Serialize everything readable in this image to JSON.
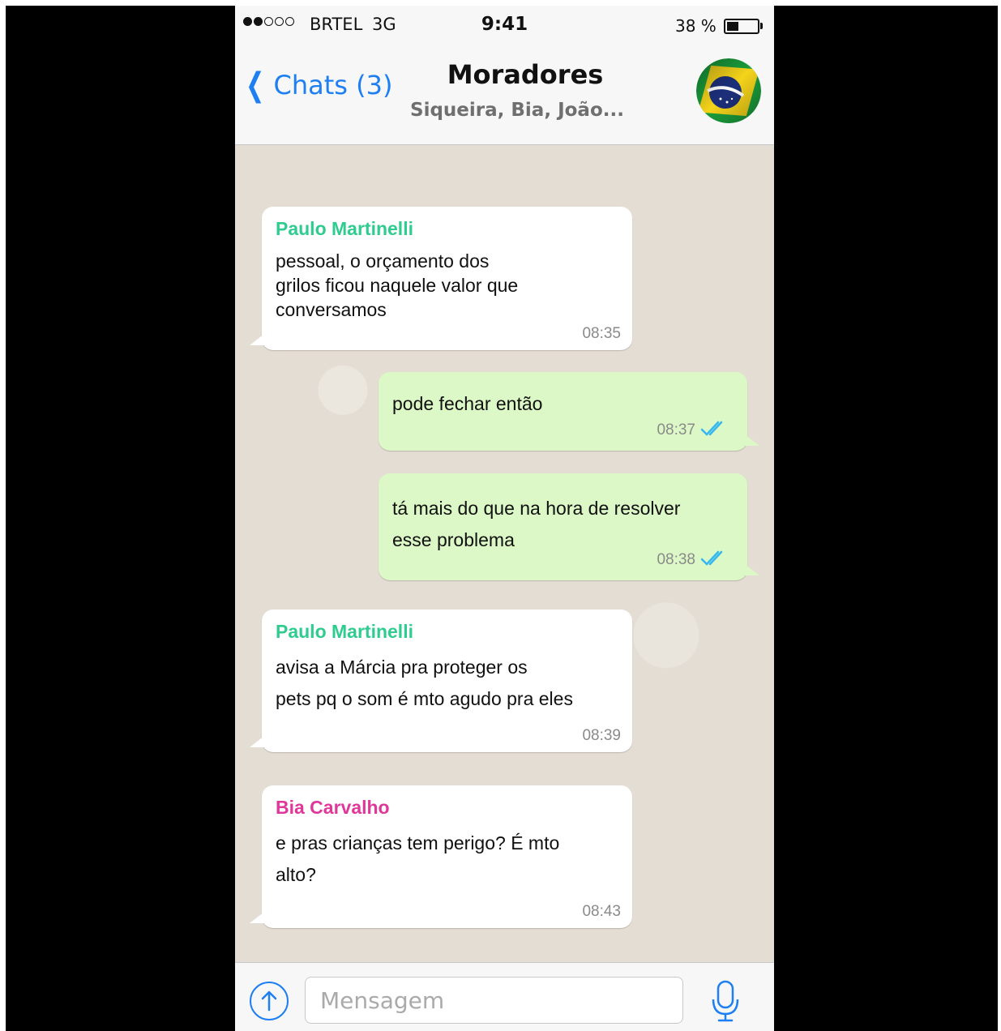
{
  "status_bar": {
    "carrier": "BRTEL",
    "network": "3G",
    "time": "9:41",
    "battery_percent": "38 %",
    "battery_level": 0.38,
    "signal_strength": 2,
    "signal_max": 5
  },
  "nav": {
    "back_label": "Chats (3)",
    "title": "Moradores",
    "subtitle": "Siqueira, Bia, João...",
    "avatar_icon": "brazil-flag-icon"
  },
  "messages": [
    {
      "direction": "in",
      "sender": "Paulo Martinelli",
      "sender_color": "#2ecc8f",
      "text": "pessoal, o orçamento dos\ngrilos ficou naquele valor que\nconversamos",
      "time": "08:35"
    },
    {
      "direction": "out",
      "text": "pode fechar então",
      "time": "08:37",
      "status": "read"
    },
    {
      "direction": "out",
      "text": "tá mais do que na hora de resolver\nesse problema",
      "time": "08:38",
      "status": "read"
    },
    {
      "direction": "in",
      "sender": "Paulo Martinelli",
      "sender_color": "#2ecc8f",
      "text": "avisa a Márcia pra proteger os\npets pq o som é mto agudo pra eles",
      "time": "08:39"
    },
    {
      "direction": "in",
      "sender": "Bia Carvalho",
      "sender_color": "#e0379a",
      "text": "e pras crianças tem perigo? É mto\nalto?",
      "time": "08:43"
    }
  ],
  "input_bar": {
    "placeholder": "Mensagem",
    "upload_icon": "upload-arrow-icon",
    "mic_icon": "microphone-icon"
  },
  "colors": {
    "accent": "#1e7ff2",
    "read_ticks": "#34b7f1",
    "outgoing_bubble": "#dcf8c6",
    "incoming_bubble": "#ffffff"
  }
}
